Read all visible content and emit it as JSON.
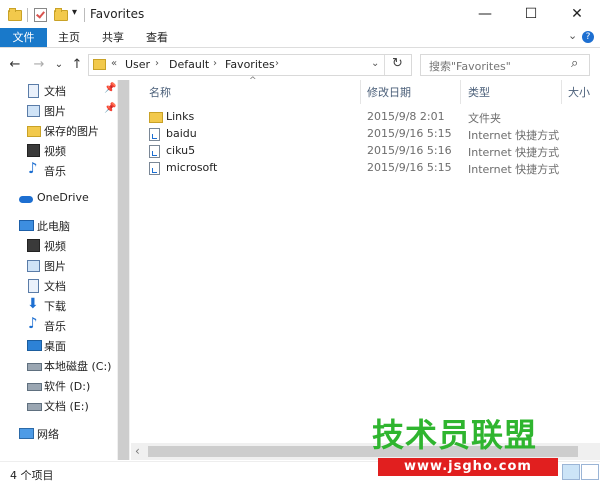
{
  "window": {
    "title": "Favorites",
    "minimize_glyph": "—",
    "maximize_glyph": "☐",
    "close_glyph": "✕"
  },
  "quick_access": {
    "dropdown_glyph": "▾"
  },
  "ribbon": {
    "tabs": [
      "文件",
      "主页",
      "共享",
      "查看"
    ],
    "expand_glyph": "⌄",
    "help_glyph": "?"
  },
  "navigation": {
    "back_glyph": "←",
    "forward_glyph": "→",
    "history_glyph": "⌄",
    "up_glyph": "↑"
  },
  "address": {
    "overflow_glyph": "«",
    "crumbs": [
      "User",
      "Default",
      "Favorites"
    ],
    "separator_glyph": "›",
    "dropdown_glyph": "⌄",
    "refresh_glyph": "↻"
  },
  "search": {
    "placeholder": "搜索\"Favorites\"",
    "icon_glyph": "⌕"
  },
  "nav_pane": {
    "pin_glyph": "📌",
    "quick": [
      {
        "label": "文档",
        "icon": "document-icon",
        "pinned": true
      },
      {
        "label": "图片",
        "icon": "pictures-icon",
        "pinned": true
      },
      {
        "label": "保存的图片",
        "icon": "folder-icon",
        "pinned": false
      },
      {
        "label": "视频",
        "icon": "videos-icon",
        "pinned": false
      },
      {
        "label": "音乐",
        "icon": "music-icon",
        "pinned": false
      }
    ],
    "onedrive": "OneDrive",
    "this_pc": "此电脑",
    "pc_items": [
      {
        "label": "视频",
        "icon": "videos-icon"
      },
      {
        "label": "图片",
        "icon": "pictures-icon"
      },
      {
        "label": "文档",
        "icon": "document-icon"
      },
      {
        "label": "下载",
        "icon": "download-icon"
      },
      {
        "label": "音乐",
        "icon": "music-icon"
      },
      {
        "label": "桌面",
        "icon": "desktop-icon"
      },
      {
        "label": "本地磁盘 (C:)",
        "icon": "drive-icon"
      },
      {
        "label": "软件 (D:)",
        "icon": "drive-icon"
      },
      {
        "label": "文档 (E:)",
        "icon": "drive-icon"
      }
    ],
    "network": "网络"
  },
  "columns": {
    "name": "名称",
    "modified": "修改日期",
    "type": "类型",
    "size": "大小",
    "sort_glyph": "^"
  },
  "files": [
    {
      "name": "Links",
      "modified": "2015/9/8 2:01",
      "type": "文件夹",
      "icon": "folder-icon"
    },
    {
      "name": "baidu",
      "modified": "2015/9/16 5:15",
      "type": "Internet 快捷方式",
      "icon": "shortcut-icon"
    },
    {
      "name": "ciku5",
      "modified": "2015/9/16 5:16",
      "type": "Internet 快捷方式",
      "icon": "shortcut-icon"
    },
    {
      "name": "microsoft",
      "modified": "2015/9/16 5:15",
      "type": "Internet 快捷方式",
      "icon": "shortcut-icon"
    }
  ],
  "scrollbar": {
    "left_glyph": "‹",
    "right_glyph": "›",
    "up_glyph": "▴",
    "down_glyph": "▾"
  },
  "status": {
    "item_count": "4 个项目"
  },
  "watermark": {
    "title": "技术员联盟",
    "url": "www.jsgho.com"
  },
  "colors": {
    "accent": "#1979ca",
    "watermark_green": "#2fb52f",
    "watermark_red": "#e11f1f"
  }
}
